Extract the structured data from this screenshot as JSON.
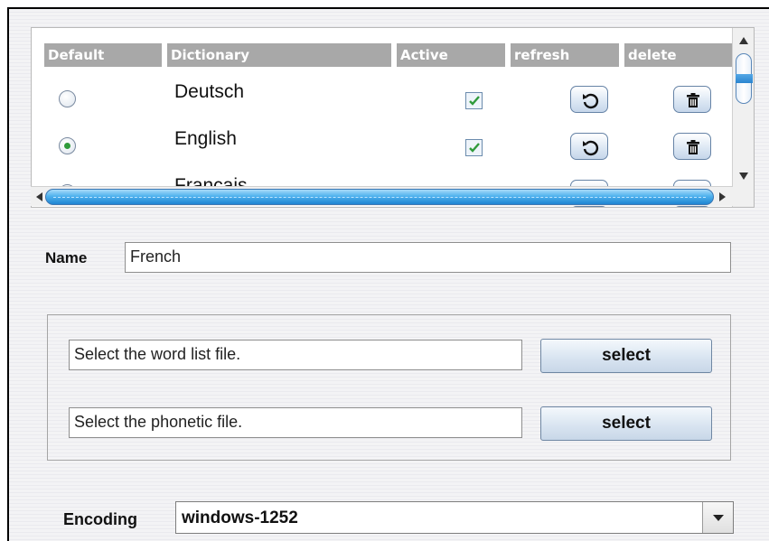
{
  "table": {
    "headers": [
      "Default",
      "Dictionary",
      "Active",
      "refresh",
      "delete"
    ],
    "rows": [
      {
        "name": "Deutsch",
        "default": false,
        "active": true
      },
      {
        "name": "English",
        "default": true,
        "active": true
      },
      {
        "name": "Français",
        "default": false,
        "active": true
      }
    ]
  },
  "form": {
    "name_label": "Name",
    "name_value": "French",
    "wordlist_value": "Select the word list file.",
    "phonetic_value": "Select the phonetic file.",
    "select_label": "select",
    "encoding_label": "Encoding",
    "encoding_value": "windows-1252"
  },
  "icons": {
    "refresh": "refresh-icon",
    "delete": "trash-icon"
  },
  "colors": {
    "header_bg": "#a8a8a8",
    "check_green": "#2f9a3a",
    "scroll_blue": "#4fb2ee"
  }
}
